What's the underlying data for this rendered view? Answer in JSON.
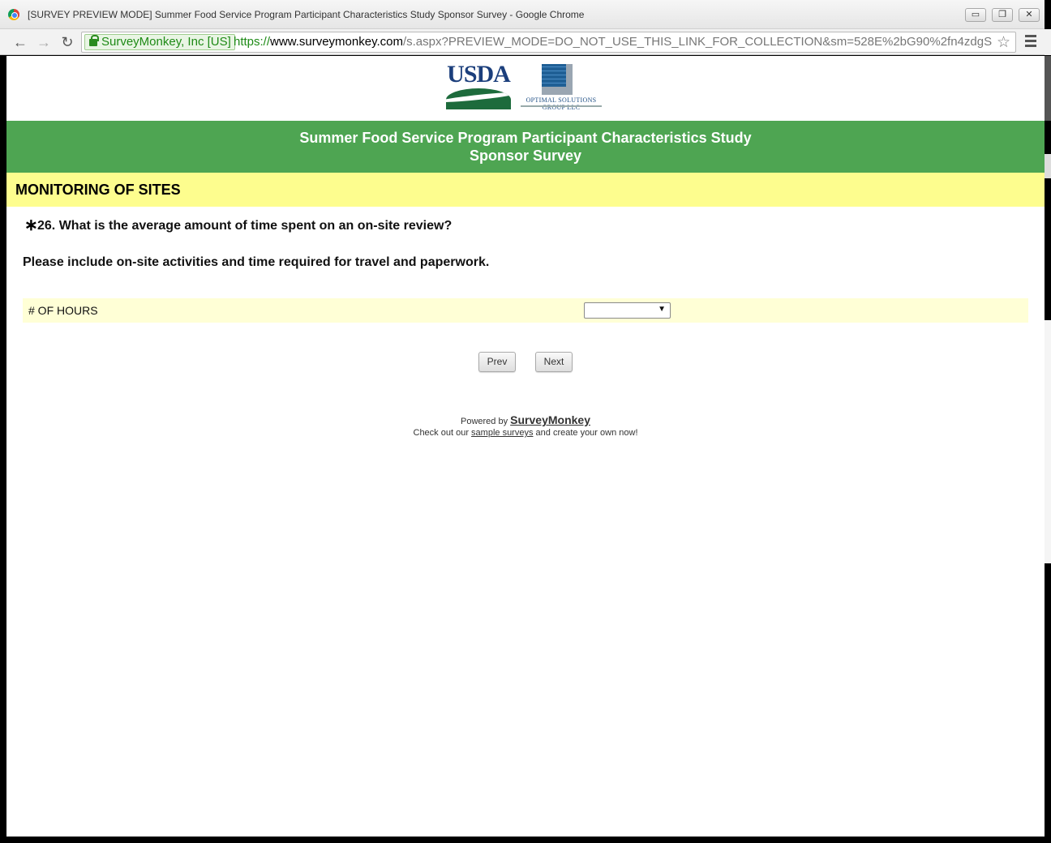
{
  "window": {
    "title": "[SURVEY PREVIEW MODE] Summer Food Service Program Participant Characteristics Study Sponsor Survey - Google Chrome",
    "minimize": "▭",
    "restore": "❐",
    "close": "✕"
  },
  "toolbar": {
    "back": "←",
    "forward": "→",
    "reload": "↻",
    "security_label": "SurveyMonkey, Inc [US]",
    "url_scheme": "https://",
    "url_host": "www.surveymonkey.com",
    "url_path": "/s.aspx?PREVIEW_MODE=DO_NOT_USE_THIS_LINK_FOR_COLLECTION&sm=528E%2bG90%2fn4zdgS",
    "star": "☆"
  },
  "logos": {
    "usda": "USDA",
    "osg_name": "OPTIMAL SOLUTIONS GROUP LLC"
  },
  "banner": {
    "line1": "Summer Food Service Program Participant Characteristics Study",
    "line2": "Sponsor Survey"
  },
  "section": {
    "title": "MONITORING OF SITES"
  },
  "question": {
    "required_mark": "∗",
    "text": "26. What is the average amount of time spent on an on-site review?",
    "help": "Please include on-site activities and time required for travel and paperwork.",
    "row_label": "# OF HOURS",
    "select_value": "",
    "select_arrow": "▼"
  },
  "buttons": {
    "prev": "Prev",
    "next": "Next"
  },
  "footer": {
    "powered_by": "Powered by",
    "brand": "SurveyMonkey",
    "check_pre": "Check out our",
    "check_link": "sample surveys",
    "check_post": "and create your own now!"
  }
}
